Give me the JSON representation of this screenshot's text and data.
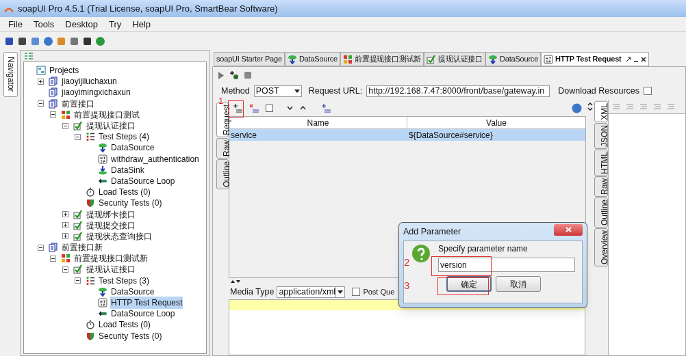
{
  "window": {
    "title": "soapUI Pro 4.5.1 (Trial License, soapUI Pro, SmartBear Software)"
  },
  "menu": [
    {
      "label": "File"
    },
    {
      "label": "Tools"
    },
    {
      "label": "Desktop"
    },
    {
      "label": "Try"
    },
    {
      "label": "Help"
    }
  ],
  "navigator": {
    "tab": "Navigator",
    "tree": {
      "label": "Projects",
      "kind": "projects",
      "selected": false,
      "children": [
        {
          "label": "jiaoyijiluchaxun",
          "kind": "project",
          "expanded": false,
          "selected": false
        },
        {
          "label": "jiaoyimingxichaxun",
          "kind": "project",
          "selected": false
        },
        {
          "label": "前置接口",
          "kind": "project",
          "expanded": true,
          "selected": false,
          "children": [
            {
              "label": "前置提现接口测试",
              "kind": "testsuite",
              "expanded": true,
              "selected": false,
              "children": [
                {
                  "label": "提现认证接口",
                  "kind": "testcase",
                  "expanded": true,
                  "selected": false,
                  "children": [
                    {
                      "label": "Test Steps (4)",
                      "kind": "steps",
                      "expanded": true,
                      "selected": false,
                      "children": [
                        {
                          "label": "DataSource",
                          "kind": "datasource",
                          "selected": false
                        },
                        {
                          "label": "withdraw_authentication",
                          "kind": "http",
                          "selected": false
                        },
                        {
                          "label": "DataSink",
                          "kind": "datasink",
                          "selected": false
                        },
                        {
                          "label": "DataSource Loop",
                          "kind": "loop",
                          "selected": false
                        }
                      ]
                    },
                    {
                      "label": "Load Tests (0)",
                      "kind": "load",
                      "selected": false
                    },
                    {
                      "label": "Security Tests (0)",
                      "kind": "security",
                      "selected": false
                    }
                  ]
                },
                {
                  "label": "提现绑卡接口",
                  "kind": "testcase",
                  "expanded": false,
                  "selected": false
                },
                {
                  "label": "提现提交接口",
                  "kind": "testcase",
                  "expanded": false,
                  "selected": false
                },
                {
                  "label": "提现状态查询接口",
                  "kind": "testcase",
                  "expanded": false,
                  "selected": false
                }
              ]
            }
          ]
        },
        {
          "label": "前置接口新",
          "kind": "project",
          "expanded": true,
          "selected": false,
          "children": [
            {
              "label": "前置提现接口测试新",
              "kind": "testsuite",
              "expanded": true,
              "selected": false,
              "children": [
                {
                  "label": "提现认证接口",
                  "kind": "testcase",
                  "expanded": true,
                  "selected": false,
                  "children": [
                    {
                      "label": "Test Steps (3)",
                      "kind": "steps",
                      "expanded": true,
                      "selected": false,
                      "children": [
                        {
                          "label": "DataSource",
                          "kind": "datasource",
                          "selected": false
                        },
                        {
                          "label": "HTTP Test Request",
                          "kind": "http",
                          "selected": true
                        },
                        {
                          "label": "DataSource Loop",
                          "kind": "loop",
                          "selected": false
                        }
                      ]
                    },
                    {
                      "label": "Load Tests (0)",
                      "kind": "load",
                      "selected": false
                    },
                    {
                      "label": "Security Tests (0)",
                      "kind": "security",
                      "selected": false
                    }
                  ]
                }
              ]
            }
          ]
        }
      ]
    }
  },
  "editor": {
    "tabs": [
      {
        "label": "soapUI Starter Page",
        "kind": "none",
        "selected": false
      },
      {
        "label": "DataSource",
        "kind": "datasource",
        "selected": false
      },
      {
        "label": "前置提现接口测试新",
        "kind": "testsuite",
        "selected": false
      },
      {
        "label": "提现认证接口",
        "kind": "testcase",
        "selected": false
      },
      {
        "label": "DataSource",
        "kind": "datasource",
        "selected": false
      },
      {
        "label": "HTTP Test Request",
        "kind": "http",
        "selected": true
      }
    ],
    "method_label": "Method",
    "method": "POST",
    "url_label": "Request URL:",
    "url": "http://192.168.7.47:8000/front/base/gateway.in",
    "download_resources": {
      "label": "Download Resources",
      "checked": false
    },
    "request_tabs": [
      {
        "label": "Request",
        "selected": true
      },
      {
        "label": "Raw",
        "selected": false
      },
      {
        "label": "Outline",
        "selected": false
      }
    ],
    "table": {
      "columns": [
        "Name",
        "Value"
      ],
      "rows": [
        {
          "cells": [
            "service",
            "${DataSource#service}"
          ],
          "selected": true
        }
      ]
    },
    "media_type_label": "Media Type",
    "media_type": "application/xml",
    "post_query": {
      "label": "Post Que",
      "checked": false
    },
    "response_tabs": [
      {
        "label": "XML",
        "selected": true
      },
      {
        "label": "JSON",
        "selected": false
      },
      {
        "label": "HTML",
        "selected": false
      },
      {
        "label": "Raw",
        "selected": false
      },
      {
        "label": "Outline",
        "selected": false
      },
      {
        "label": "Overview",
        "selected": false
      }
    ]
  },
  "dialog": {
    "title": "Add Parameter",
    "message": "Specify parameter name",
    "value": "version",
    "buttons": [
      "确定",
      "取消"
    ]
  },
  "annotations": [
    "1",
    "2",
    "3"
  ]
}
